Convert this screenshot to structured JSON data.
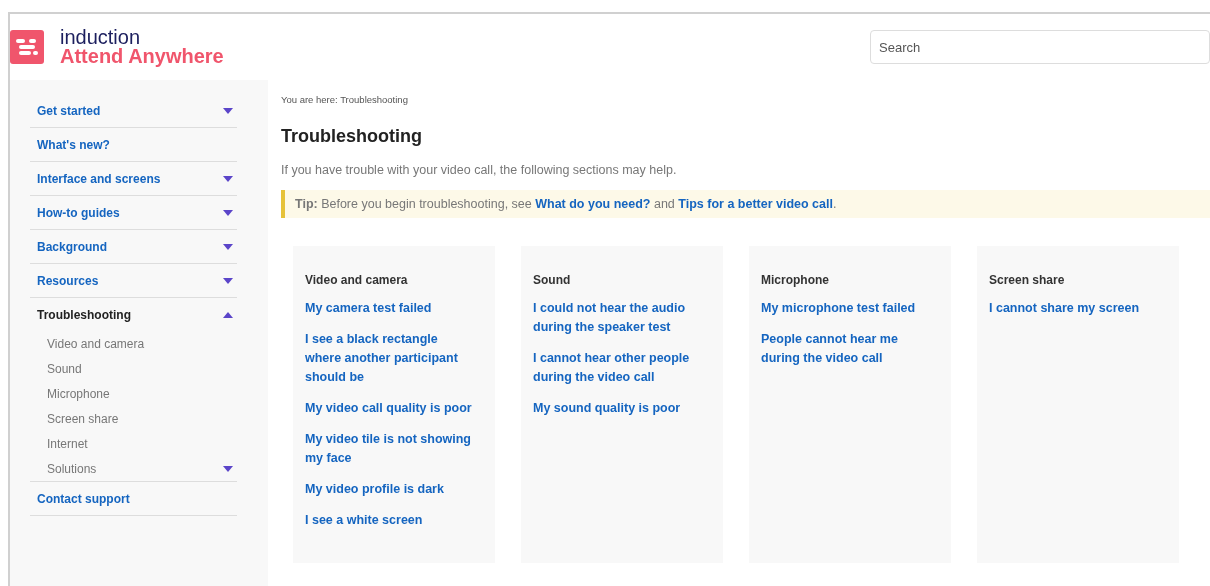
{
  "header": {
    "brand_top": "induction",
    "brand_bottom": "Attend Anywhere",
    "search": {
      "placeholder": "Search"
    }
  },
  "sidebar": {
    "items": [
      {
        "label": "Get started",
        "selected": false,
        "expanded": false
      },
      {
        "label": "What's new?",
        "selected": false
      },
      {
        "label": "Interface and screens",
        "selected": false,
        "expanded": false
      },
      {
        "label": "How-to guides",
        "selected": false,
        "expanded": false
      },
      {
        "label": "Background",
        "selected": false,
        "expanded": false
      },
      {
        "label": "Resources",
        "selected": false,
        "expanded": false
      },
      {
        "label": "Troubleshooting",
        "selected": true,
        "expanded": true,
        "children": [
          {
            "label": "Video and camera"
          },
          {
            "label": "Sound"
          },
          {
            "label": "Microphone"
          },
          {
            "label": "Screen share"
          },
          {
            "label": "Internet"
          },
          {
            "label": "Solutions",
            "expanded": false
          }
        ]
      },
      {
        "label": "Contact support",
        "selected": false
      }
    ]
  },
  "breadcrumb": "You are here: Troubleshooting",
  "title": "Troubleshooting",
  "intro": "If you have trouble with your video call, the following sections may help.",
  "tip": {
    "label": "Tip:",
    "text": " Before you begin troubleshooting, see ",
    "links": [
      "What do you need?",
      "Tips for a better video call"
    ],
    "joiner": " and ",
    "end": "."
  },
  "cards": [
    {
      "title": "Video and camera",
      "links": [
        "My camera test failed",
        "I see a black rectangle where another participant should be",
        "My video call quality is poor",
        "My video tile is not showing my face",
        "My video profile is dark",
        "I see a white screen"
      ]
    },
    {
      "title": "Sound",
      "links": [
        "I could not hear the audio during the speaker test",
        "I cannot hear other people during the video call",
        "My sound quality is poor"
      ]
    },
    {
      "title": "Microphone",
      "links": [
        "My microphone test failed",
        "People cannot hear me during the video call"
      ]
    },
    {
      "title": "Screen share",
      "links": [
        "I cannot share my screen"
      ]
    }
  ]
}
